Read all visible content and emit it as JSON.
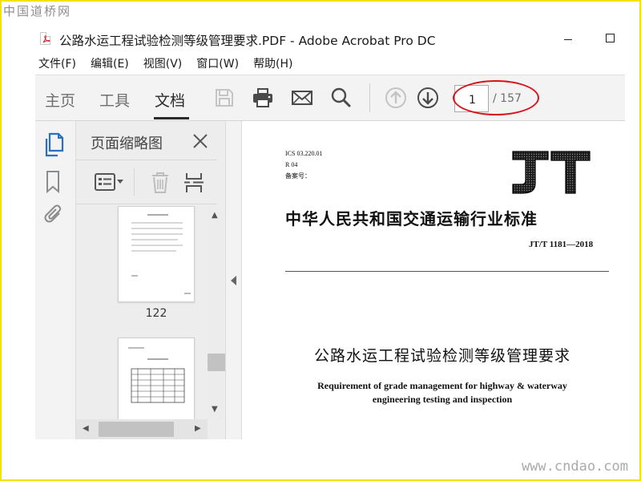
{
  "watermark": {
    "top": "中国道桥网",
    "bottom": "www.cndao.com"
  },
  "window": {
    "title": "公路水运工程试验检测等级管理要求.PDF - Adobe Acrobat Pro DC"
  },
  "menu": [
    "文件(F)",
    "编辑(E)",
    "视图(V)",
    "窗口(W)",
    "帮助(H)"
  ],
  "toolbar": {
    "tabs": [
      "主页",
      "工具",
      "文档"
    ],
    "active_tab": "文档",
    "icons": [
      "save-icon",
      "print-icon",
      "mail-icon",
      "search-icon",
      "page-up-icon",
      "page-down-icon"
    ],
    "page_current": "1",
    "page_total": "/ 157"
  },
  "left_rail": {
    "icons": [
      "pages-icon",
      "bookmark-icon",
      "attachment-icon"
    ]
  },
  "thumbnail_panel": {
    "title": "页面缩略图",
    "tool_icons": [
      "options-icon",
      "delete-icon",
      "insert-page-icon"
    ],
    "thumbnails": [
      {
        "label": "122"
      },
      {
        "label": ""
      }
    ]
  },
  "document": {
    "meta": [
      "ICS 03.220.01",
      "R 04",
      "备案号："
    ],
    "logo_text": "JT",
    "organization": "中华人民共和国交通运输行业标准",
    "code": "JT/T 1181—2018",
    "title_cn": "公路水运工程试验检测等级管理要求",
    "title_en": [
      "Requirement of grade management for highway & waterway",
      "engineering testing and inspection"
    ]
  },
  "colors": {
    "annotation": "#d8141a",
    "frame": "#f2e400",
    "toolbar_bg": "#f3f3f3"
  }
}
